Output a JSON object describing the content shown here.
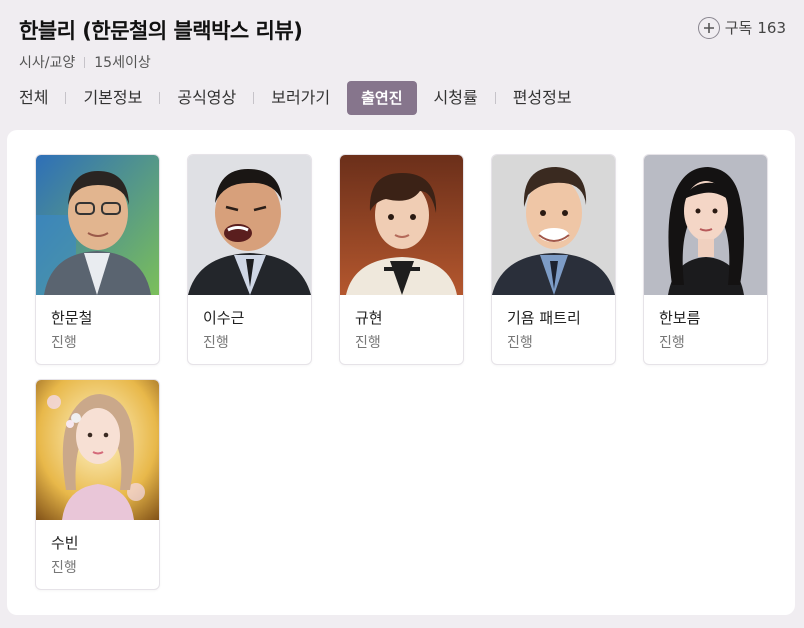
{
  "program": {
    "title": "한블리 (한문철의 블랙박스 리뷰)",
    "genre": "시사/교양",
    "rating": "15세이상"
  },
  "subscribe": {
    "label": "구독",
    "count": "163"
  },
  "tabs": [
    {
      "label": "전체"
    },
    {
      "label": "기본정보"
    },
    {
      "label": "공식영상"
    },
    {
      "label": "보러가기"
    },
    {
      "label": "출연진",
      "active": true
    },
    {
      "label": "시청률"
    },
    {
      "label": "편성정보"
    }
  ],
  "cast": [
    {
      "name": "한문철",
      "role": "진행"
    },
    {
      "name": "이수근",
      "role": "진행"
    },
    {
      "name": "규현",
      "role": "진행"
    },
    {
      "name": "기욤 패트리",
      "role": "진행"
    },
    {
      "name": "한보름",
      "role": "진행"
    },
    {
      "name": "수빈",
      "role": "진행"
    }
  ],
  "colors": {
    "active_tab": "#86758c",
    "page_bg": "#f0edf1"
  }
}
